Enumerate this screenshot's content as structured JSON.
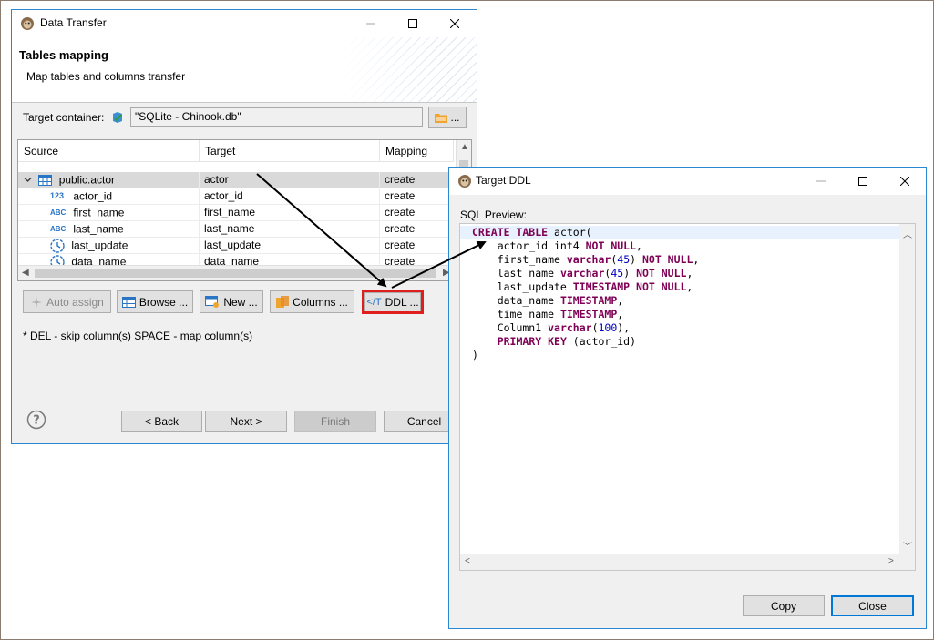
{
  "data_transfer": {
    "title": "Data Transfer",
    "page_title": "Tables mapping",
    "page_description": "Map tables and columns transfer",
    "target_container_label": "Target container:",
    "target_container_value": "\"SQLite - Chinook.db\"",
    "target_container_button": "...",
    "columns": [
      "Source",
      "Target",
      "Mapping"
    ],
    "rows": [
      {
        "source": "public.actor",
        "target": "actor",
        "mapping": "create",
        "icon": "table-icon",
        "expanded": true
      },
      {
        "source": "actor_id",
        "target": "actor_id",
        "mapping": "create",
        "icon": "numeric-type-icon",
        "type_label": "123"
      },
      {
        "source": "first_name",
        "target": "first_name",
        "mapping": "create",
        "icon": "string-type-icon",
        "type_label": "ABC"
      },
      {
        "source": "last_name",
        "target": "last_name",
        "mapping": "create",
        "icon": "string-type-icon",
        "type_label": "ABC"
      },
      {
        "source": "last_update",
        "target": "last_update",
        "mapping": "create",
        "icon": "datetime-type-icon"
      },
      {
        "source": "data_name",
        "target": "data_name",
        "mapping": "create",
        "icon": "datetime-type-icon"
      }
    ],
    "toolbar": {
      "auto_assign": "Auto assign",
      "browse": "Browse ...",
      "new": "New ...",
      "columns": "Columns ...",
      "ddl": "DDL ..."
    },
    "hint": "* DEL - skip column(s)  SPACE - map column(s)",
    "nav": {
      "back": "< Back",
      "next": "Next >",
      "finish": "Finish",
      "cancel": "Cancel"
    }
  },
  "target_ddl": {
    "title": "Target DDL",
    "sql_label": "SQL Preview:",
    "sql_lines": [
      "CREATE TABLE actor(",
      "    actor_id int4 NOT NULL,",
      "    first_name varchar(45) NOT NULL,",
      "    last_name varchar(45) NOT NULL,",
      "    last_update TIMESTAMP NOT NULL,",
      "    data_name TIMESTAMP,",
      "    time_name TIMESTAMP,",
      "    Column1 varchar(100),",
      "    PRIMARY KEY (actor_id)",
      ")"
    ],
    "copy_button": "Copy",
    "close_button": "Close"
  },
  "colors": {
    "window_border": "#2b87cf",
    "highlight_red": "#e01e1e",
    "sql_keyword": "#7f0055",
    "sql_number": "#0000c0"
  }
}
